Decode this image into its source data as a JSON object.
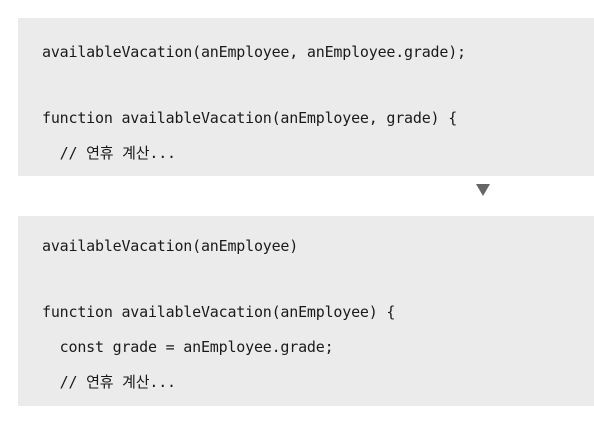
{
  "before": {
    "lines": [
      "availableVacation(anEmployee, anEmployee.grade);",
      "",
      "function availableVacation(anEmployee, grade) {",
      "  // 연휴 계산..."
    ]
  },
  "arrow_icon": "down-triangle-icon",
  "after": {
    "lines": [
      "availableVacation(anEmployee)",
      "",
      "function availableVacation(anEmployee) {",
      "  const grade = anEmployee.grade;",
      "  // 연휴 계산..."
    ]
  }
}
